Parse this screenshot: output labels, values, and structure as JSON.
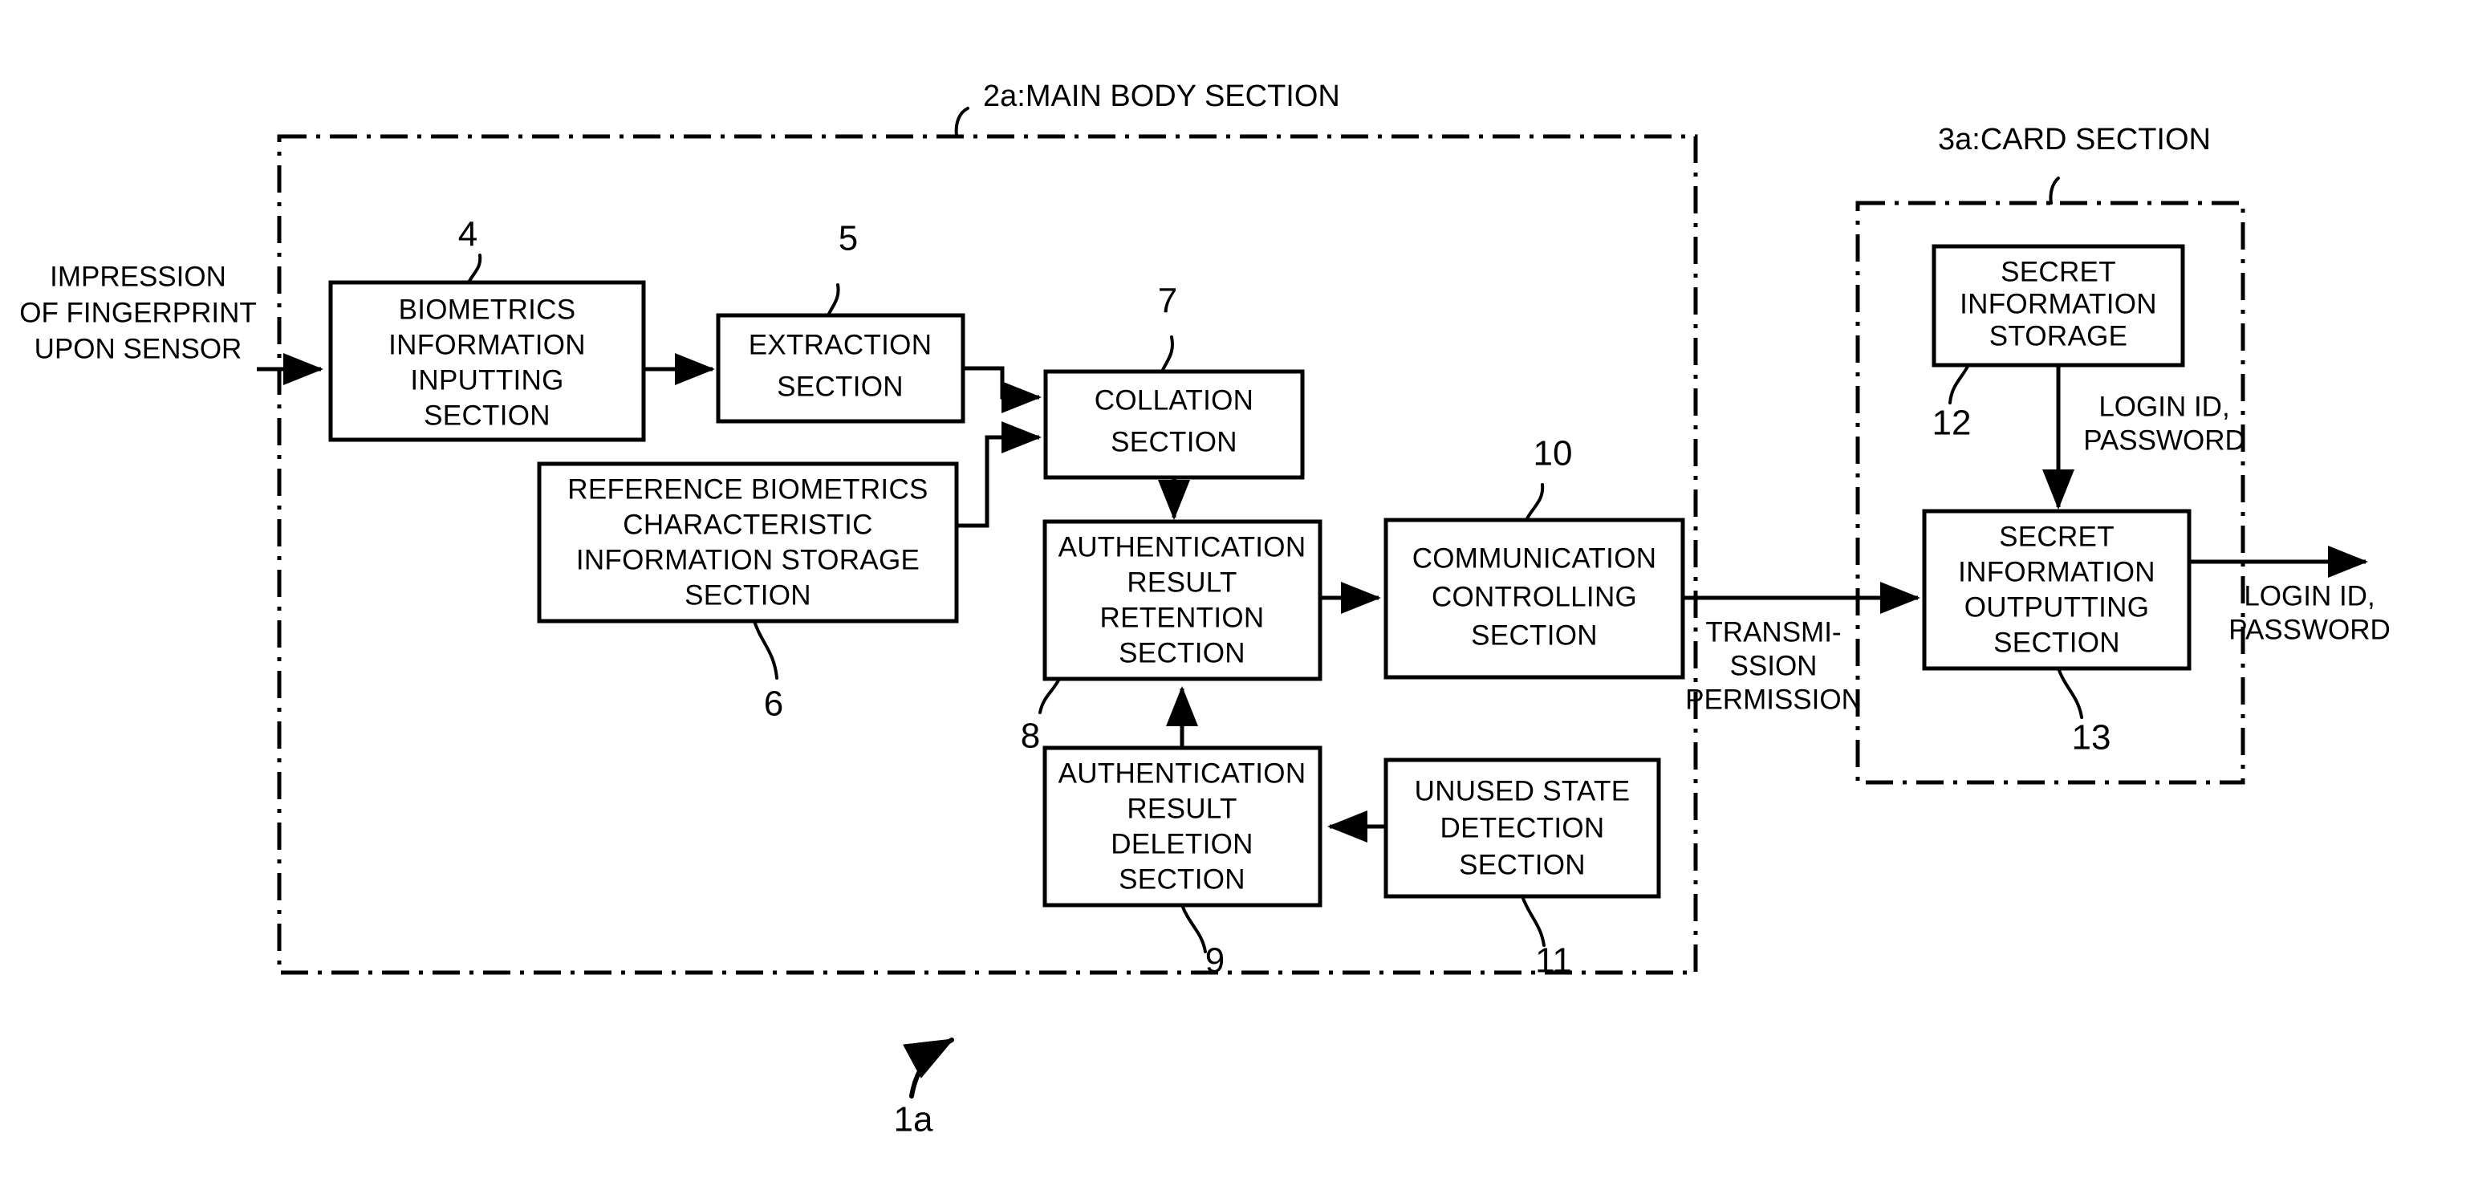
{
  "figure": {
    "kind": "patent-block-diagram",
    "overall_reference": "1a",
    "background_color": "#ffffff",
    "line_color": "#000000"
  },
  "enclosures": [
    {
      "id": "main-body",
      "ref": "2a",
      "title": "2a:MAIN BODY SECTION",
      "style": "dash-dot"
    },
    {
      "id": "card",
      "ref": "3a",
      "title": "3a:CARD SECTION",
      "style": "dash-dot"
    }
  ],
  "boxes": [
    {
      "id": "biometrics-information-inputting-section",
      "ref": "4",
      "lines": [
        "BIOMETRICS",
        "INFORMATION",
        "INPUTTING",
        "SECTION"
      ]
    },
    {
      "id": "extraction-section",
      "ref": "5",
      "lines": [
        "EXTRACTION",
        "SECTION"
      ]
    },
    {
      "id": "reference-biometrics-characteristic-information-storage-section",
      "ref": "6",
      "lines": [
        "REFERENCE BIOMETRICS",
        "CHARACTERISTIC",
        "INFORMATION STORAGE",
        "SECTION"
      ]
    },
    {
      "id": "collation-section",
      "ref": "7",
      "lines": [
        "COLLATION",
        "SECTION"
      ]
    },
    {
      "id": "authentication-result-retention-section",
      "ref": "8",
      "lines": [
        "AUTHENTICATION",
        "RESULT",
        "RETENTION",
        "SECTION"
      ]
    },
    {
      "id": "authentication-result-deletion-section",
      "ref": "9",
      "lines": [
        "AUTHENTICATION",
        "RESULT",
        "DELETION",
        "SECTION"
      ]
    },
    {
      "id": "communication-controlling-section",
      "ref": "10",
      "lines": [
        "COMMUNICATION",
        "CONTROLLING",
        "SECTION"
      ]
    },
    {
      "id": "unused-state-detection-section",
      "ref": "11",
      "lines": [
        "UNUSED STATE",
        "DETECTION",
        "SECTION"
      ]
    },
    {
      "id": "secret-information-storage",
      "ref": "12",
      "lines": [
        "SECRET",
        "INFORMATION",
        "STORAGE"
      ]
    },
    {
      "id": "secret-information-outputting-section",
      "ref": "13",
      "lines": [
        "SECRET",
        "INFORMATION",
        "OUTPUTTING",
        "SECTION"
      ]
    }
  ],
  "flow_labels": [
    {
      "id": "input-label",
      "lines": [
        "IMPRESSION",
        "OF FINGERPRINT",
        "UPON SENSOR"
      ]
    },
    {
      "id": "transmission-permission-label",
      "lines": [
        "TRANSMI-",
        "SSION",
        "PERMISSION"
      ]
    },
    {
      "id": "card-internal-credentials-label",
      "lines": [
        "LOGIN ID,",
        "PASSWORD"
      ]
    },
    {
      "id": "output-credentials-label",
      "lines": [
        "LOGIN ID,",
        "PASSWORD"
      ]
    }
  ],
  "reference_numerals": {
    "n4": "4",
    "n5": "5",
    "n6": "6",
    "n7": "7",
    "n8": "8",
    "n9": "9",
    "n10": "10",
    "n11": "11",
    "n12": "12",
    "n13": "13",
    "n1a": "1a",
    "main_body_title": "2a:MAIN BODY SECTION",
    "card_title": "3a:CARD SECTION"
  },
  "box_text": {
    "biometrics_l1": "BIOMETRICS",
    "biometrics_l2": "INFORMATION",
    "biometrics_l3": "INPUTTING",
    "biometrics_l4": "SECTION",
    "extraction_l1": "EXTRACTION",
    "extraction_l2": "SECTION",
    "reference_l1": "REFERENCE BIOMETRICS",
    "reference_l2": "CHARACTERISTIC",
    "reference_l3": "INFORMATION STORAGE",
    "reference_l4": "SECTION",
    "collation_l1": "COLLATION",
    "collation_l2": "SECTION",
    "retention_l1": "AUTHENTICATION",
    "retention_l2": "RESULT",
    "retention_l3": "RETENTION",
    "retention_l4": "SECTION",
    "deletion_l1": "AUTHENTICATION",
    "deletion_l2": "RESULT",
    "deletion_l3": "DELETION",
    "deletion_l4": "SECTION",
    "comm_l1": "COMMUNICATION",
    "comm_l2": "CONTROLLING",
    "comm_l3": "SECTION",
    "unused_l1": "UNUSED STATE",
    "unused_l2": "DETECTION",
    "unused_l3": "SECTION",
    "secret_storage_l1": "SECRET",
    "secret_storage_l2": "INFORMATION",
    "secret_storage_l3": "STORAGE",
    "secret_out_l1": "SECRET",
    "secret_out_l2": "INFORMATION",
    "secret_out_l3": "OUTPUTTING",
    "secret_out_l4": "SECTION"
  },
  "label_text": {
    "input_l1": "IMPRESSION",
    "input_l2": "OF FINGERPRINT",
    "input_l3": "UPON SENSOR",
    "transmission_l1": "TRANSMI-",
    "transmission_l2": "SSION",
    "transmission_l3": "PERMISSION",
    "card_cred_l1": "LOGIN ID,",
    "card_cred_l2": "PASSWORD",
    "out_cred_l1": "LOGIN ID,",
    "out_cred_l2": "PASSWORD"
  }
}
